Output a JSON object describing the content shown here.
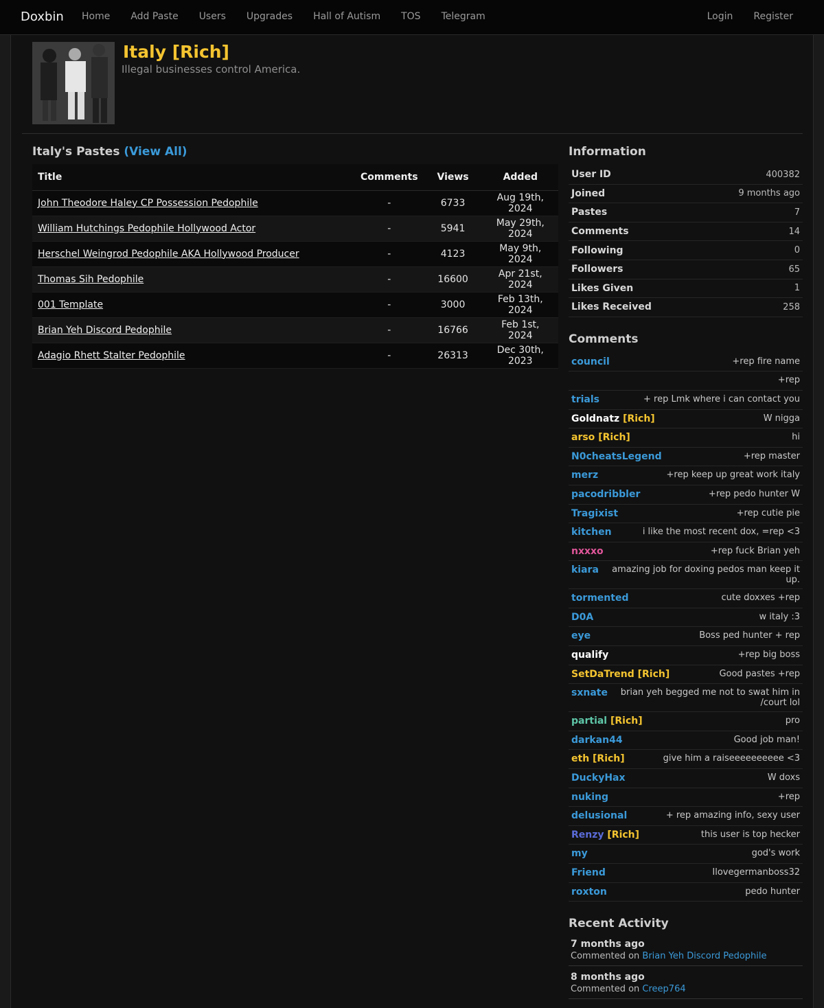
{
  "nav": {
    "brand": "Doxbin",
    "links": [
      "Home",
      "Add Paste",
      "Users",
      "Upgrades",
      "Hall of Autism",
      "TOS",
      "Telegram"
    ],
    "right": [
      "Login",
      "Register"
    ]
  },
  "profile": {
    "name": "Italy [Rich]",
    "tagline": "Illegal businesses control America."
  },
  "pastes": {
    "title": "Italy's Pastes",
    "view_all": "(View All)",
    "headers": [
      "Title",
      "Comments",
      "Views",
      "Added"
    ],
    "rows": [
      {
        "title": "John Theodore Haley CP Possession Pedophile",
        "comments": "-",
        "views": "6733",
        "added": "Aug 19th, 2024"
      },
      {
        "title": "William Hutchings Pedophile Hollywood Actor",
        "comments": "-",
        "views": "5941",
        "added": "May 29th, 2024"
      },
      {
        "title": "Herschel Weingrod Pedophile AKA Hollywood Producer",
        "comments": "-",
        "views": "4123",
        "added": "May 9th, 2024"
      },
      {
        "title": "Thomas Sih Pedophile",
        "comments": "-",
        "views": "16600",
        "added": "Apr 21st, 2024"
      },
      {
        "title": "001 Template",
        "comments": "-",
        "views": "3000",
        "added": "Feb 13th, 2024"
      },
      {
        "title": "Brian Yeh Discord Pedophile",
        "comments": "-",
        "views": "16766",
        "added": "Feb 1st, 2024"
      },
      {
        "title": "Adagio Rhett Stalter Pedophile",
        "comments": "-",
        "views": "26313",
        "added": "Dec 30th, 2023"
      }
    ]
  },
  "information": {
    "title": "Information",
    "rows": [
      {
        "k": "User ID",
        "v": "400382"
      },
      {
        "k": "Joined",
        "v": "9 months ago"
      },
      {
        "k": "Pastes",
        "v": "7"
      },
      {
        "k": "Comments",
        "v": "14"
      },
      {
        "k": "Following",
        "v": "0"
      },
      {
        "k": "Followers",
        "v": "65"
      },
      {
        "k": "Likes Given",
        "v": "1"
      },
      {
        "k": "Likes Received",
        "v": "258"
      }
    ]
  },
  "comments": {
    "title": "Comments",
    "rows": [
      {
        "user": "council",
        "rich": "",
        "color": "#3b9ad9",
        "msg": "+rep fire name"
      },
      {
        "user": "",
        "rich": "",
        "color": "#3b9ad9",
        "msg": "+rep"
      },
      {
        "user": "trials",
        "rich": "",
        "color": "#3b9ad9",
        "msg": "+ rep Lmk where i can contact you"
      },
      {
        "user": "Goldnatz",
        "rich": "[Rich]",
        "color": "#ffffff",
        "msg": "W nigga"
      },
      {
        "user": "arso",
        "rich": "[Rich]",
        "color": "#f4c430",
        "msg": "hi"
      },
      {
        "user": "N0cheatsLegend",
        "rich": "",
        "color": "#3b9ad9",
        "msg": "+rep master"
      },
      {
        "user": "merz",
        "rich": "",
        "color": "#3b9ad9",
        "msg": "+rep keep up great work italy"
      },
      {
        "user": "pacodribbler",
        "rich": "",
        "color": "#3b9ad9",
        "msg": "+rep pedo hunter W"
      },
      {
        "user": "Tragixist",
        "rich": "",
        "color": "#3b9ad9",
        "msg": "+rep cutie pie"
      },
      {
        "user": "kitchen",
        "rich": "",
        "color": "#3b9ad9",
        "msg": "i like the most recent dox, =rep <3"
      },
      {
        "user": "nxxxo",
        "rich": "",
        "color": "#e0569a",
        "msg": "+rep fuck Brian yeh"
      },
      {
        "user": "kiara",
        "rich": "",
        "color": "#3b9ad9",
        "msg": "amazing job for doxing pedos man keep it up."
      },
      {
        "user": "tormented",
        "rich": "",
        "color": "#3b9ad9",
        "msg": "cute doxxes +rep"
      },
      {
        "user": "D0A",
        "rich": "",
        "color": "#3b9ad9",
        "msg": "w italy :3"
      },
      {
        "user": "eye",
        "rich": "",
        "color": "#3b9ad9",
        "msg": "Boss ped hunter + rep"
      },
      {
        "user": "qualify",
        "rich": "",
        "color": "#ffffff",
        "msg": "+rep big boss"
      },
      {
        "user": "SetDaTrend",
        "rich": "[Rich]",
        "color": "#f4c430",
        "msg": "Good pastes +rep"
      },
      {
        "user": "sxnate",
        "rich": "",
        "color": "#3b9ad9",
        "msg": "brian yeh begged me not to swat him in /court lol"
      },
      {
        "user": "partial",
        "rich": "[Rich]",
        "color": "#5fc7a8",
        "msg": "pro"
      },
      {
        "user": "darkan44",
        "rich": "",
        "color": "#3b9ad9",
        "msg": "Good job man!"
      },
      {
        "user": "eth",
        "rich": "[Rich]",
        "color": "#f4c430",
        "msg": "give him a raiseeeeeeeeee <3"
      },
      {
        "user": "DuckyHax",
        "rich": "",
        "color": "#3b9ad9",
        "msg": "W doxs"
      },
      {
        "user": "nuking",
        "rich": "",
        "color": "#3b9ad9",
        "msg": "+rep"
      },
      {
        "user": "delusional",
        "rich": "",
        "color": "#3b9ad9",
        "msg": "+ rep amazing info, sexy user"
      },
      {
        "user": "Renzy",
        "rich": "[Rich]",
        "color": "#5a6bd8",
        "msg": "this user is top hecker"
      },
      {
        "user": "my",
        "rich": "",
        "color": "#3b9ad9",
        "msg": "god's work"
      },
      {
        "user": "Friend",
        "rich": "",
        "color": "#3b9ad9",
        "msg": "Ilovegermanboss32"
      },
      {
        "user": "roxton",
        "rich": "",
        "color": "#3b9ad9",
        "msg": "pedo hunter"
      }
    ]
  },
  "activity": {
    "title": "Recent Activity",
    "items": [
      {
        "when": "7 months ago",
        "prefix": "Commented on",
        "target": "Brian Yeh Discord Pedophile"
      },
      {
        "when": "8 months ago",
        "prefix": "Commented on",
        "target": "Creep764"
      }
    ]
  }
}
